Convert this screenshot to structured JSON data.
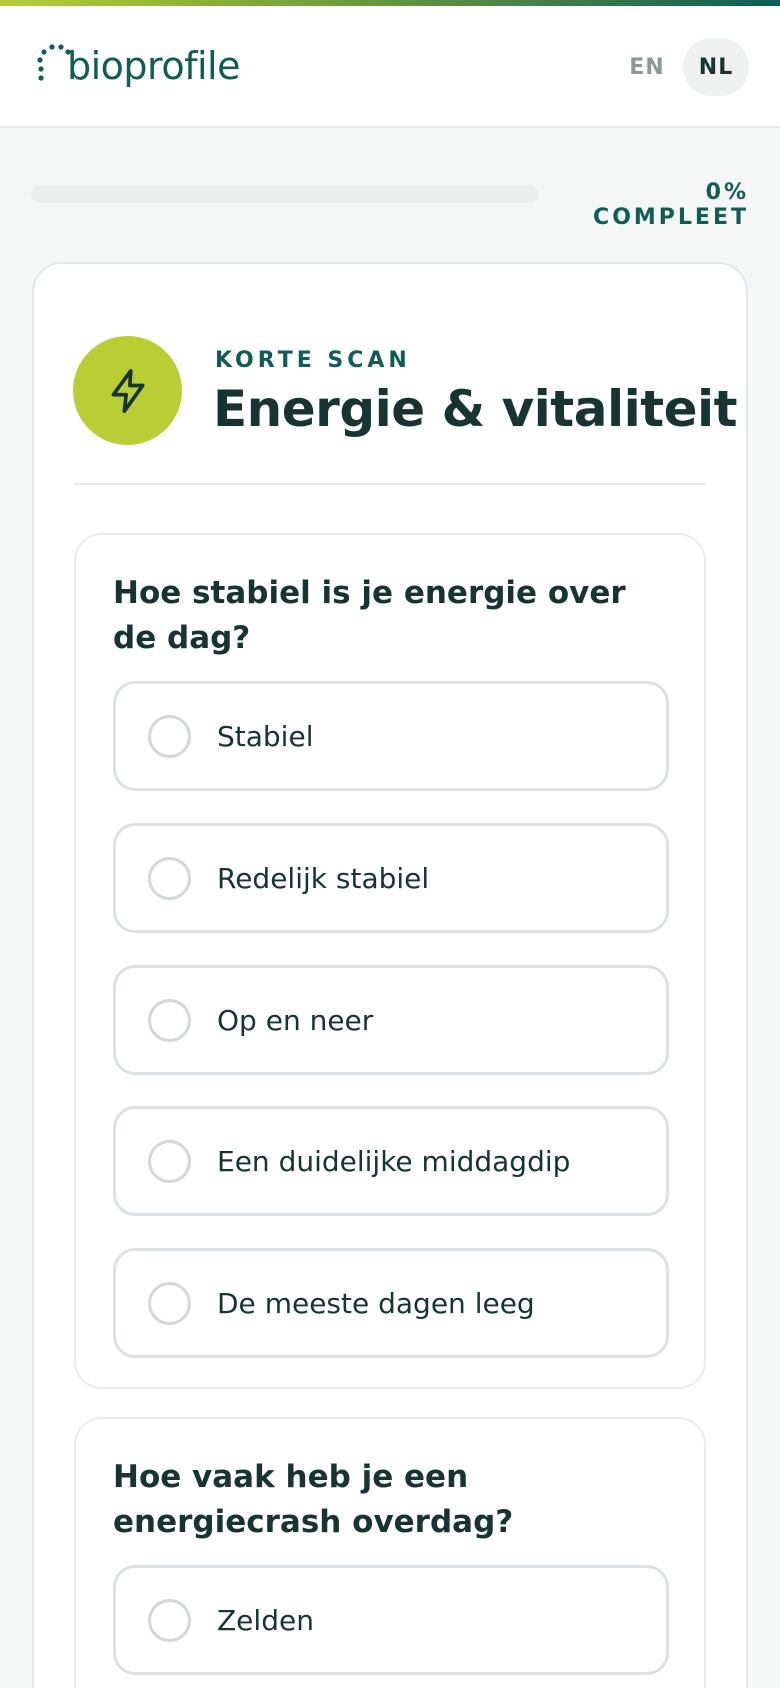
{
  "header": {
    "logo_text": "bioprofile",
    "lang_en": "EN",
    "lang_nl": "NL",
    "active_language": "NL"
  },
  "progress": {
    "percent": 0,
    "label": "0% COMPLEET"
  },
  "section": {
    "icon": "lightning-bolt-icon",
    "kicker": "KORTE SCAN",
    "title": "Energie & vitaliteit"
  },
  "questions": [
    {
      "text": "Hoe stabiel is je energie over de dag?",
      "options": [
        "Stabiel",
        "Redelijk stabiel",
        "Op en neer",
        "Een duidelijke middagdip",
        "De meeste dagen leeg"
      ]
    },
    {
      "text": "Hoe vaak heb je een energiecrash overdag?",
      "options": [
        "Zelden"
      ]
    }
  ],
  "colors": {
    "brand_dark": "#0f5d55",
    "brand_lime": "#b9ce35",
    "text": "#173433"
  }
}
